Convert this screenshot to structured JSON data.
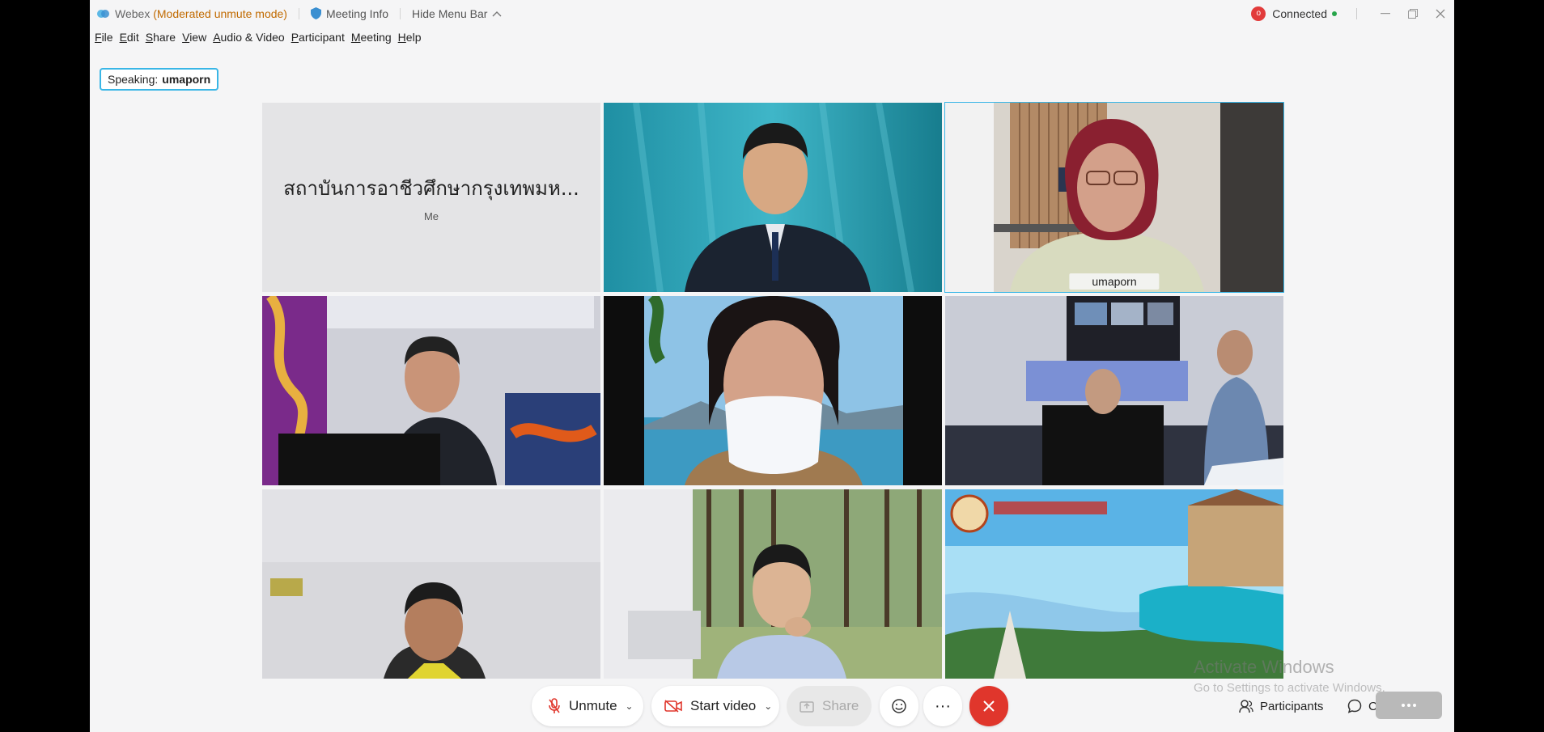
{
  "titlebar": {
    "app_name": "Webex",
    "mode": "(Moderated unmute mode)",
    "meeting_info": "Meeting Info",
    "hide_menu": "Hide Menu Bar",
    "rec_letter": "o",
    "status": "Connected"
  },
  "menu": [
    "File",
    "Edit",
    "Share",
    "View",
    "Audio & Video",
    "Participant",
    "Meeting",
    "Help"
  ],
  "speaking": {
    "prefix": "Speaking:",
    "name": "umaporn"
  },
  "self_tile": {
    "name": "สถาบันการอาชีวศึกษากรุงเทพมห...",
    "sub": "Me"
  },
  "active_tile": {
    "name": "umaporn"
  },
  "controls": {
    "unmute": "Unmute",
    "start_video": "Start video",
    "share": "Share",
    "more": "···",
    "participants": "Participants",
    "chat": "Chat"
  },
  "watermark": {
    "line1": "Activate Windows",
    "line2": "Go to Settings to activate Windows."
  },
  "colors": {
    "accent": "#39b6e6",
    "leave": "#e0362c",
    "mode": "#c16a00",
    "connected": "#27a54a"
  },
  "icons": [
    "webex-logo-icon",
    "shield-icon",
    "chevron-up-icon",
    "record-icon",
    "minimize-icon",
    "restore-icon",
    "close-icon",
    "mic-muted-icon",
    "video-off-icon",
    "share-icon",
    "reactions-icon",
    "more-icon",
    "leave-icon",
    "participants-icon",
    "chat-icon"
  ]
}
